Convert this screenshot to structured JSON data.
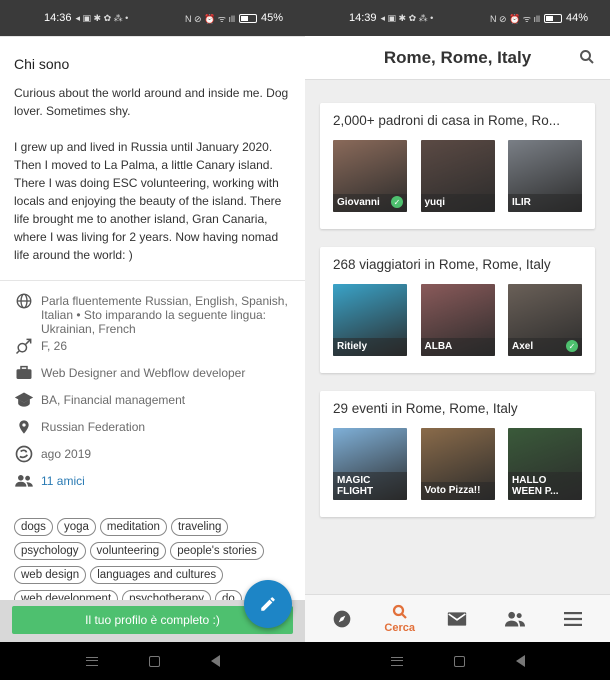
{
  "left": {
    "status": {
      "time": "14:36",
      "battery": "45%",
      "battery_fraction": 0.45
    },
    "section_title": "Chi sono",
    "about": [
      "Curious about the world around and inside me. Dog lover.  Sometimes shy.",
      "I grew up and lived in Russia until January 2020. Then I moved to La Palma, a little Canary island. There I was doing ESC volunteering, working with locals and enjoying the beauty of the island. There life brought me to another island, Gran Canaria, where I was living for 2 years. Now having nomad life around the world: )"
    ],
    "facts": {
      "languages": "Parla fluentemente Russian, English, Spanish, Italian • Sto imparando la seguente lingua: Ukrainian, French",
      "gender_age": "F, 26",
      "occupation": "Web Designer and Webflow developer",
      "education": "BA, Financial management",
      "country": "Russian Federation",
      "member_since": "ago 2019",
      "friends": "11 amici"
    },
    "tags": [
      "dogs",
      "yoga",
      "meditation",
      "traveling",
      "psychology",
      "volunteering",
      "people's stories",
      "web design",
      "languages and cultures",
      "web development",
      "psychotherapy",
      "do"
    ],
    "complete_button": "Il tuo profilo è completo :)",
    "icons": {
      "fab": "pencil-icon"
    }
  },
  "right": {
    "status": {
      "time": "14:39",
      "battery": "44%",
      "battery_fraction": 0.44
    },
    "title": "Rome, Rome, Italy",
    "cards": [
      {
        "title": "2,000+ padroni di casa in Rome, Ro...",
        "items": [
          {
            "label": "Giovanni",
            "verified": true,
            "bg": "#8a6a5a"
          },
          {
            "label": "yuqi",
            "verified": false,
            "bg": "#5b4a44"
          },
          {
            "label": "ILIR",
            "verified": false,
            "bg": "#7a7f86"
          }
        ]
      },
      {
        "title": "268 viaggiatori in Rome, Rome, Italy",
        "items": [
          {
            "label": "Ritiely",
            "verified": false,
            "bg": "#3aa3c8"
          },
          {
            "label": "ALBA",
            "verified": false,
            "bg": "#8a5a5a"
          },
          {
            "label": "Axel",
            "verified": true,
            "bg": "#6a6058"
          }
        ]
      },
      {
        "title": "29 eventi in Rome, Rome, Italy",
        "items": [
          {
            "label": "MAGIC FLIGHT",
            "verified": false,
            "bg": "#7fb0d8"
          },
          {
            "label": "Voto Pizza!!",
            "verified": false,
            "bg": "#8a6b4a"
          },
          {
            "label": "HALLO WEEN P...",
            "verified": false,
            "bg": "#3a5a3a"
          }
        ]
      }
    ],
    "tabs": [
      {
        "icon": "compass-icon",
        "label": ""
      },
      {
        "icon": "search-icon",
        "label": "Cerca",
        "active": true
      },
      {
        "icon": "mail-icon",
        "label": ""
      },
      {
        "icon": "people-icon",
        "label": ""
      },
      {
        "icon": "menu-icon",
        "label": ""
      }
    ]
  },
  "colors": {
    "accent": "#e2703a",
    "link": "#2a7ab3",
    "success": "#4ec06f",
    "fab": "#1d85c6"
  }
}
